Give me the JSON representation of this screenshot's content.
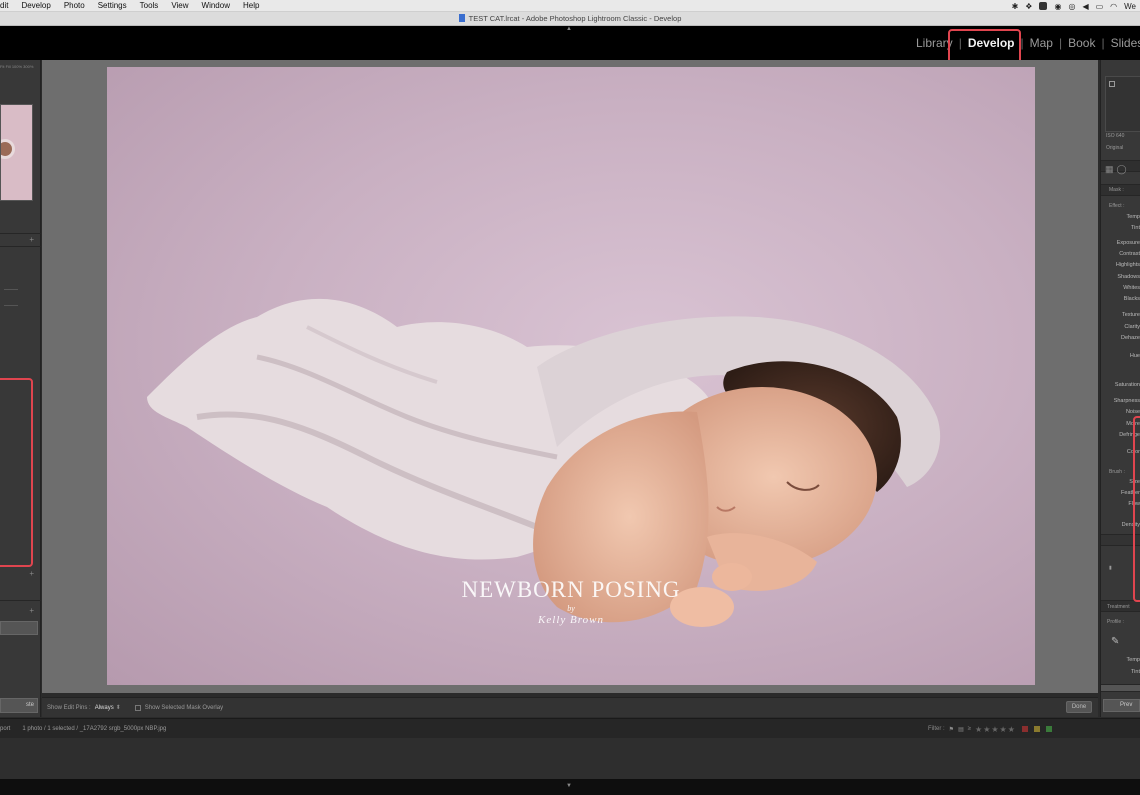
{
  "menubar": {
    "items": [
      "dit",
      "Develop",
      "Photo",
      "Settings",
      "Tools",
      "View",
      "Window",
      "Help"
    ],
    "right_text": "We"
  },
  "window": {
    "title": "TEST CAT.lrcat - Adobe Photoshop Lightroom Classic - Develop"
  },
  "modules": {
    "items": [
      "Library",
      "Develop",
      "Map",
      "Book",
      "Slidesho"
    ],
    "active": "Develop"
  },
  "left_panel": {
    "zoom_labels": [
      "Fit",
      "Fill",
      "100%",
      "300%"
    ],
    "button_label": "ste"
  },
  "photo": {
    "watermark_title": "NEWBORN POSING",
    "watermark_by": "by",
    "watermark_name": "Kelly Brown"
  },
  "toolbar": {
    "edit_pins_label": "Show Edit Pins :",
    "edit_pins_value": "Always",
    "mask_overlay_label": "Show Selected Mask Overlay",
    "done_label": "Done"
  },
  "right_panel": {
    "iso": "ISO 640",
    "original": "Original",
    "mask_label": "Mask :",
    "effect_label": "Effect :",
    "sliders": [
      "Temp",
      "Tint",
      "Exposure",
      "Contrast",
      "Highlights",
      "Shadows",
      "Whites",
      "Blacks",
      "Texture",
      "Clarity",
      "Dehaze",
      "Hue",
      "Saturation",
      "Sharpness",
      "Noise",
      "Moire",
      "Defringe",
      "Color"
    ],
    "brush_label": "Brush :",
    "brush_sliders": [
      "Size",
      "Feather",
      "Flow",
      "Density"
    ],
    "treatment_label": "Treatment",
    "profile_label": "Profile :",
    "wb_sliders": [
      "Temp",
      "Tint"
    ],
    "button_label": "Prev"
  },
  "filmbar": {
    "source_label": "port",
    "file_info": "1 photo / 1 selected / _17A2792 srgb_5000px NBP.jpg",
    "filter_label": "Filter :"
  }
}
